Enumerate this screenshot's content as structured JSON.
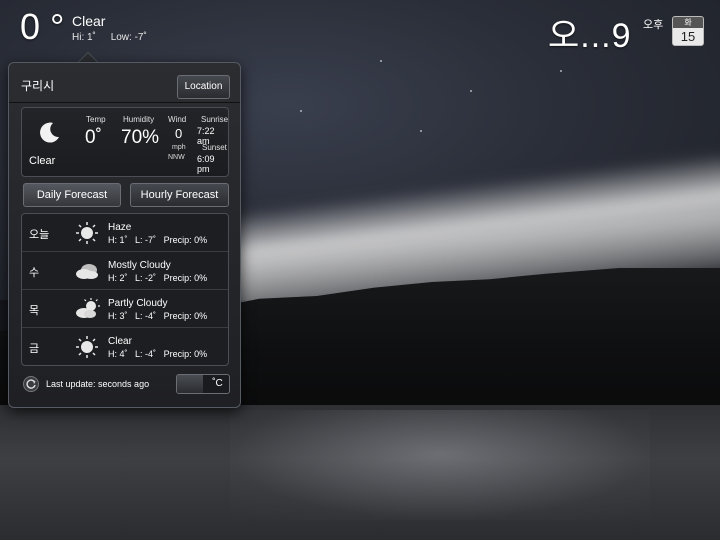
{
  "top": {
    "temp": "0 °",
    "condition": "Clear",
    "hi": "Hi: 1˚",
    "low": "Low: -7˚"
  },
  "clock": {
    "time": "오...9",
    "ampm": "오후",
    "cal_day": "화",
    "cal_date": "15"
  },
  "panel": {
    "city": "구리시",
    "location_button": "Location",
    "current": {
      "icon": "moon-icon",
      "condition": "Clear",
      "temp_label": "Temp",
      "temp_value": "0˚",
      "humidity_label": "Humidity",
      "humidity_value": "70%",
      "wind_label": "Wind",
      "wind_value": "0",
      "wind_unit": "mph",
      "wind_dir": "NNW",
      "sunrise_label": "Sunrise",
      "sunrise_value": "7:22 am",
      "sunset_label": "Sunset",
      "sunset_value": "6:09 pm"
    },
    "daily_button": "Daily Forecast",
    "hourly_button": "Hourly Forecast",
    "forecast": [
      {
        "day": "오늘",
        "icon": "sun-icon",
        "condition": "Haze",
        "hi": "H: 1˚",
        "lo": "L: -7˚",
        "precip": "Precip: 0%"
      },
      {
        "day": "수",
        "icon": "cloud-icon",
        "condition": "Mostly Cloudy",
        "hi": "H: 2˚",
        "lo": "L: -2˚",
        "precip": "Precip: 0%"
      },
      {
        "day": "목",
        "icon": "partly-cloudy-icon",
        "condition": "Partly Cloudy",
        "hi": "H: 3˚",
        "lo": "L: -4˚",
        "precip": "Precip: 0%"
      },
      {
        "day": "금",
        "icon": "sun-icon",
        "condition": "Clear",
        "hi": "H: 4˚",
        "lo": "L: -4˚",
        "precip": "Precip: 0%"
      }
    ],
    "last_update": "Last update: seconds ago",
    "unit": "˚C"
  }
}
